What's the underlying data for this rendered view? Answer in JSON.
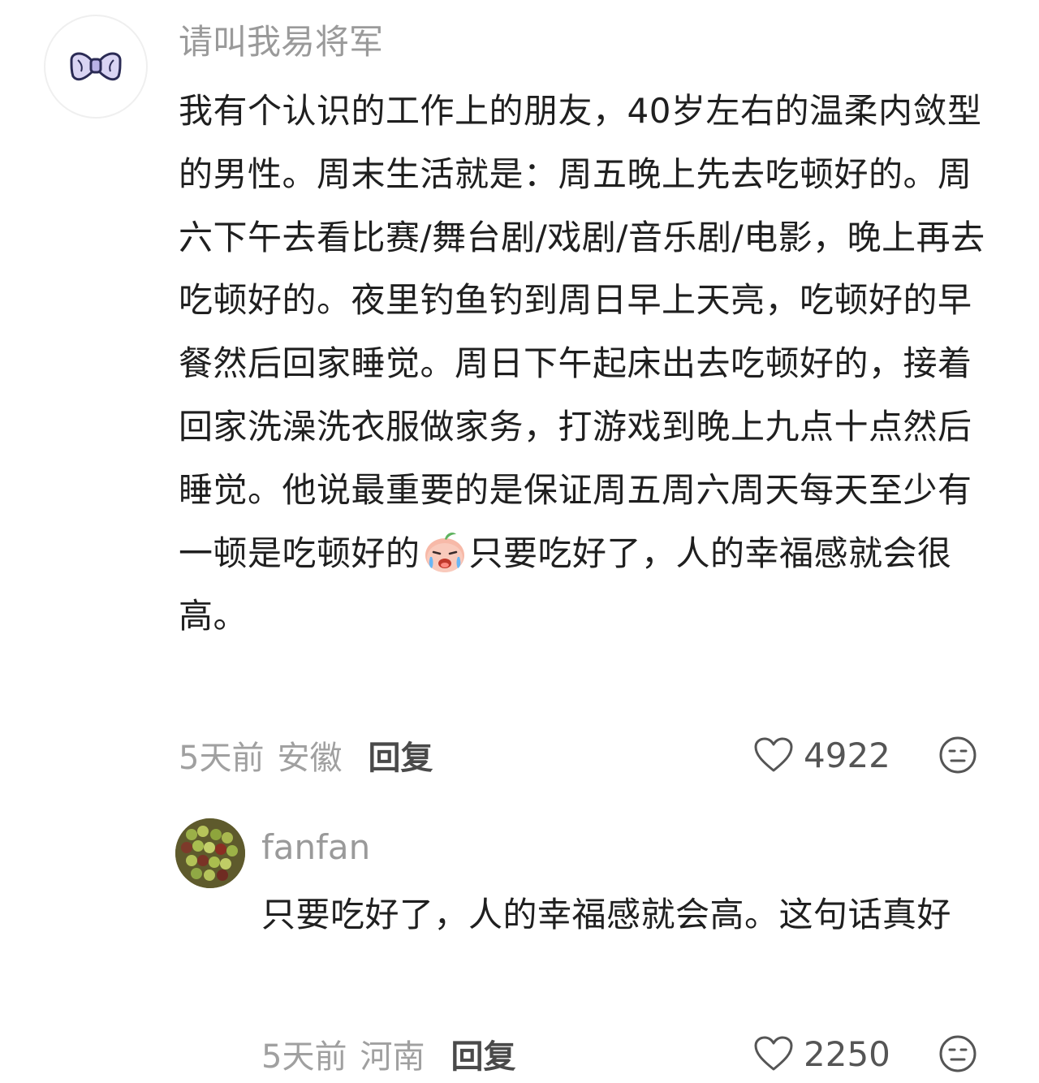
{
  "comments": [
    {
      "author": "请叫我易将军",
      "avatar_icon": "bow-tie-avatar",
      "text_before_emoji": "我有个认识的工作上的朋友，40岁左右的温柔内敛型的男性。周末生活就是：周五晚上先去吃顿好的。周六下午去看比赛/舞台剧/戏剧/音乐剧/电影，晚上再去吃顿好的。夜里钓鱼钓到周日早上天亮，吃顿好的早餐然后回家睡觉。周日下午起床出去吃顿好的，接着回家洗澡洗衣服做家务，打游戏到晚上九点十点然后睡觉。他说最重要的是保证周五周六周天每天至少有一顿是吃顿好的",
      "emoji_icon": "crying-peach-emoji",
      "text_after_emoji": "只要吃好了，人的幸福感就会很高。",
      "time": "5天前",
      "location": "安徽",
      "reply_label": "回复",
      "likes": "4922"
    },
    {
      "author": "fanfan",
      "avatar_icon": "grapes-photo-avatar",
      "text": "只要吃好了，人的幸福感就会高。这句话真好",
      "time": "5天前",
      "location": "河南",
      "reply_label": "回复",
      "likes": "2250"
    }
  ],
  "colors": {
    "background": "#ffffff",
    "author": "#9a9a9a",
    "text": "#1f1f1f",
    "meta": "#a0a0a0",
    "reply": "#4a4a4a"
  }
}
